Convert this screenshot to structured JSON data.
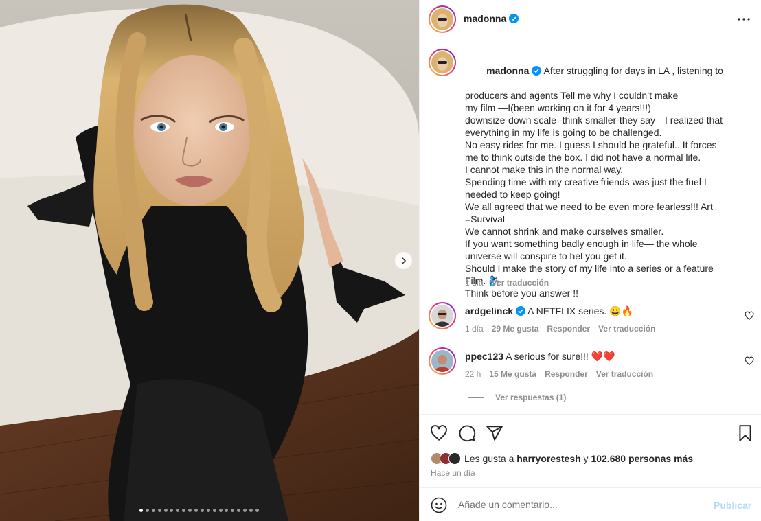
{
  "post": {
    "username": "madonna",
    "caption_lines": [
      "After struggling for days in LA , listening to",
      "producers and agents Tell me why I couldn’t make",
      "my film —I(been working on it for 4 years!!!)",
      "downsize-down scale -think smaller-they say—I realized that",
      "everything in my life is going to be challenged.",
      "No easy rides for me. I guess I should be grateful.. It forces",
      "me to think outside the box. I did not have a normal life.",
      "I cannot make this in the normal way.",
      "Spending time with my creative friends was just the fuel I",
      "needed to keep going!",
      "We all agreed that we need to be even more fearless!!! Art",
      "=Survival",
      "We cannot shrink and make ourselves smaller.",
      "If you want something badly enough in life— the whole",
      "universe will conspire to hel you get it.",
      "Should I make the story of my life into a series or a feature",
      "Film. 🧞‍♀️",
      "Think before you answer !!"
    ],
    "caption_time": "1 día",
    "caption_translate": "Ver traducción"
  },
  "comments": [
    {
      "username": "ardgelinck",
      "text": "A NETFLIX series. 😀🔥",
      "time": "1 día",
      "likes": "29 Me gusta",
      "reply": "Responder",
      "translate": "Ver traducción"
    },
    {
      "username": "ppec123",
      "text": "A serious for sure!!! ❤️❤️",
      "time": "22 h",
      "likes": "15 Me gusta",
      "reply": "Responder",
      "translate": "Ver traducción"
    }
  ],
  "view_replies": "Ver respuestas (1)",
  "likes": {
    "prefix": "Les gusta a ",
    "user": "harryorestesh",
    "middle": " y ",
    "others": "102.680 personas más"
  },
  "time_ago": "Hace un día",
  "comment_box": {
    "placeholder": "Añade un comentario...",
    "publish": "Publicar"
  },
  "carousel": {
    "total": 20,
    "active_index": 0
  },
  "colors": {
    "verified": "#0095f6",
    "muted": "#8e8e8e",
    "text": "#262626",
    "publish_disabled": "#b3dbff"
  }
}
